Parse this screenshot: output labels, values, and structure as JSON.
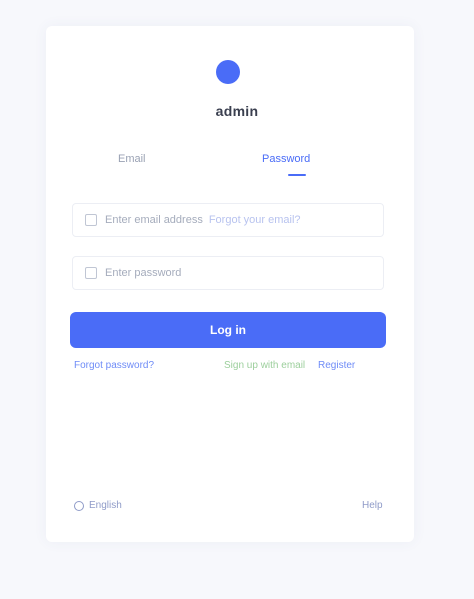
{
  "brand": {
    "name": "admin"
  },
  "tabs": [
    {
      "label": "Email"
    },
    {
      "label": "Password"
    }
  ],
  "form": {
    "username_placeholder": "Enter email address",
    "username_hint": "Forgot your email?",
    "password_placeholder": "Enter password",
    "submit_label": "Log in"
  },
  "links": {
    "forgot": "Forgot password?",
    "middle": "Sign up with email",
    "register": "Register"
  },
  "footer": {
    "language": "English",
    "help": "Help"
  },
  "colors": {
    "accent": "#4a6cf7",
    "background": "#f7f8fc"
  }
}
